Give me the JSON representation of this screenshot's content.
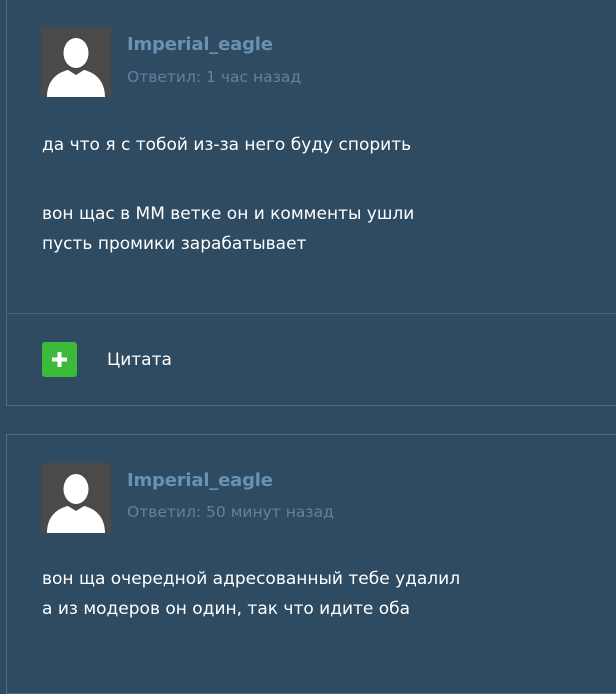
{
  "posts": [
    {
      "author": "Imperial_eagle",
      "meta": "Ответил: 1 час назад",
      "paragraphs": [
        [
          "да что я с тобой из-за него буду спорить"
        ],
        [
          "вон щас в ММ ветке он и комменты ушли",
          "пусть промики зарабатывает"
        ]
      ],
      "quote_label": "Цитата"
    },
    {
      "author": "Imperial_eagle",
      "meta": "Ответил: 50 минут назад",
      "paragraphs": [
        [
          "вон ща очередной адресованный тебе удалил",
          "а из модеров он один, так что идите оба"
        ]
      ]
    }
  ],
  "icons": {
    "avatar": "default-user-avatar-icon",
    "quote": "plus-icon"
  },
  "colors": {
    "background": "#2e4b62",
    "author": "#6891b4",
    "meta": "#5f82a1",
    "text": "#ffffff",
    "quote_button": "#3cba3a",
    "border": "#4e6a80"
  }
}
